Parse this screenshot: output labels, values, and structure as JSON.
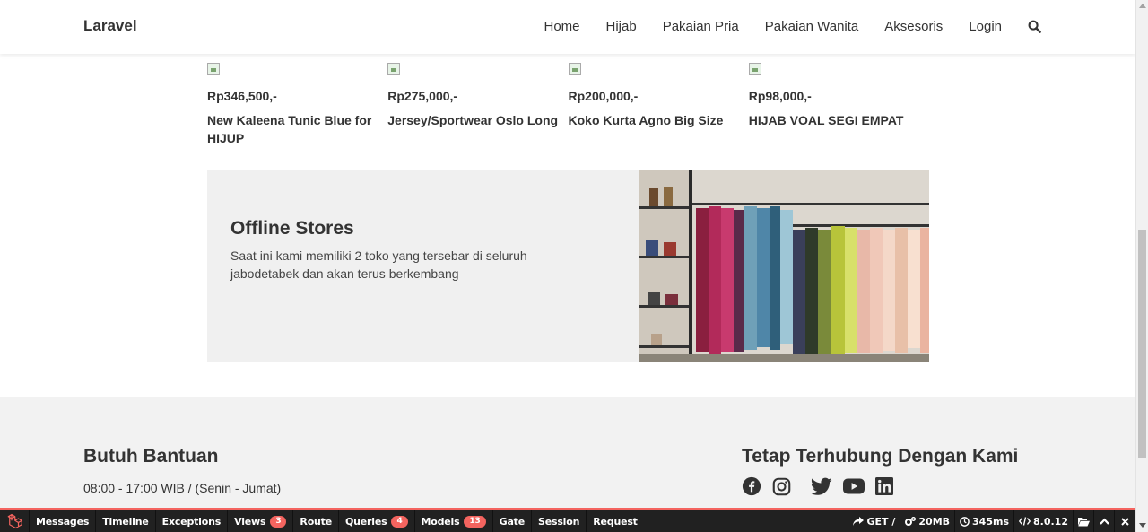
{
  "navbar": {
    "brand": "Laravel",
    "items": [
      {
        "label": "Home"
      },
      {
        "label": "Hijab"
      },
      {
        "label": "Pakaian Pria"
      },
      {
        "label": "Pakaian Wanita"
      },
      {
        "label": "Aksesoris"
      },
      {
        "label": "Login"
      }
    ],
    "search_icon": "search-icon"
  },
  "products": [
    {
      "price": "Rp346,500,-",
      "name": "New Kaleena Tunic Blue for HIJUP"
    },
    {
      "price": "Rp275,000,-",
      "name": "Jersey/Sportwear Oslo Long"
    },
    {
      "price": "Rp200,000,-",
      "name": "Koko Kurta Agno Big Size"
    },
    {
      "price": "Rp98,000,-",
      "name": "HIJAB VOAL SEGI EMPAT"
    }
  ],
  "banner": {
    "title": "Offline Stores",
    "text": "Saat ini kami memiliki 2 toko yang tersebar di seluruh jabodetabek dan akan terus berkembang"
  },
  "footer": {
    "help_title": "Butuh Bantuan",
    "help_hours": "08:00 - 17:00 WIB / (Senin - Jumat)",
    "contact_title": "Tetap Terhubung Dengan Kami",
    "socials": [
      "facebook-icon",
      "instagram-icon",
      "twitter-icon",
      "youtube-icon",
      "linkedin-icon"
    ]
  },
  "debugbar": {
    "tabs": [
      {
        "label": "Messages"
      },
      {
        "label": "Timeline"
      },
      {
        "label": "Exceptions"
      },
      {
        "label": "Views",
        "badge": "3"
      },
      {
        "label": "Route"
      },
      {
        "label": "Queries",
        "badge": "4"
      },
      {
        "label": "Models",
        "badge": "13"
      },
      {
        "label": "Gate"
      },
      {
        "label": "Session"
      },
      {
        "label": "Request"
      }
    ],
    "method": "GET /",
    "memory": "20MB",
    "time": "345ms",
    "php_version": "8.0.12",
    "accent_color": "#f4645f"
  }
}
